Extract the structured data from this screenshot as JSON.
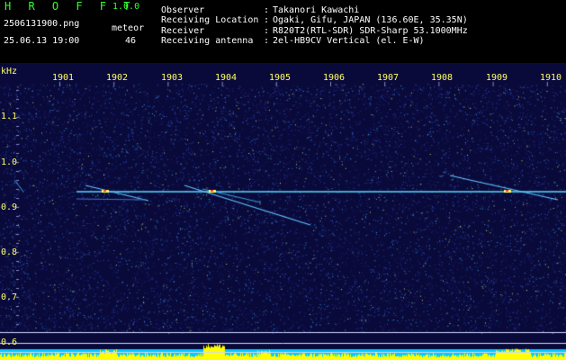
{
  "header": {
    "app_title": "HROFFT",
    "app_version": "1.0.0",
    "filename": "2506131900.png",
    "datetime": "25.06.13 19:00",
    "meteor_label": "meteor",
    "meteor_count": "46",
    "observer_key": "Observer",
    "observer_value": "Takanori Kawachi",
    "location_key": "Receiving Location",
    "location_value": "Ogaki, Gifu, JAPAN (136.60E, 35.35N)",
    "receiver_key": "Receiver",
    "receiver_value": "R820T2(RTL-SDR) SDR-Sharp 53.1000MHz",
    "antenna_key": "Receiving antenna",
    "antenna_value": "2el-HB9CV Vertical (el. E-W)",
    "separator": ":"
  },
  "axes": {
    "unit": "kHz",
    "x_ticks": [
      "1901",
      "1902",
      "1903",
      "1904",
      "1905",
      "1906",
      "1907",
      "1908",
      "1909",
      "1910"
    ],
    "y_ticks": [
      "1.1",
      "1.0",
      "0.9",
      "0.8",
      "0.7",
      "0.6"
    ]
  },
  "colors": {
    "background": "#000000",
    "spectrogram_bg": "#0a0a3a",
    "axis_text": "#ffff66",
    "header_green": "#33ff33",
    "signal_cyan": "#55ddff",
    "level_yellow": "#ffff00",
    "level_cyan": "#00ccff"
  }
}
